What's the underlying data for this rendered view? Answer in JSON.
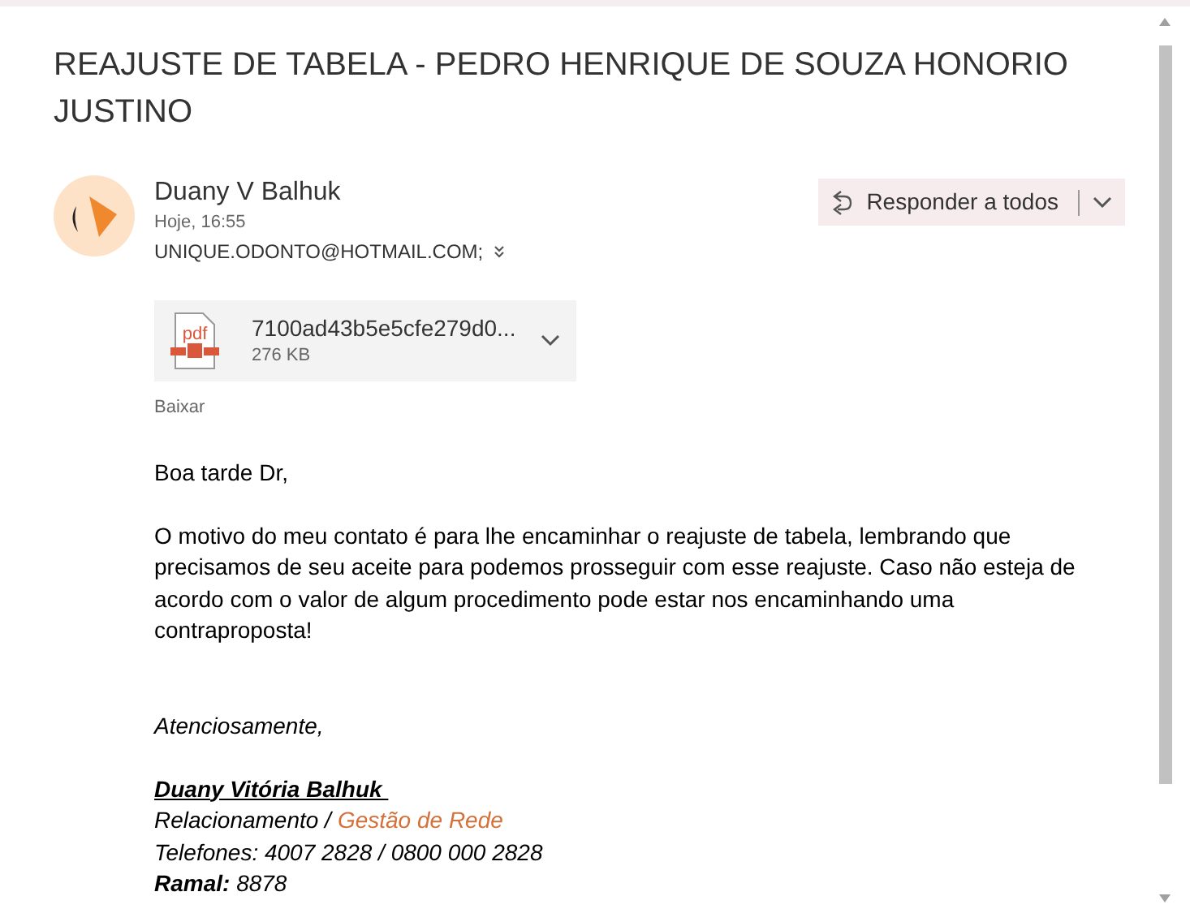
{
  "subject": "REAJUSTE DE TABELA - PEDRO HENRIQUE DE SOUZA HONORIO JUSTINO",
  "sender": {
    "name": "Duany V Balhuk",
    "time": "Hoje, 16:55",
    "to": "UNIQUE.ODONTO@HOTMAIL.COM;"
  },
  "reply_button": {
    "label": "Responder a todos"
  },
  "attachment": {
    "filename": "7100ad43b5e5cfe279d0...",
    "size": "276 KB",
    "file_type": "pdf",
    "download": "Baixar"
  },
  "body": [
    "Boa tarde Dr,",
    "O motivo do meu contato é para lhe encaminhar o reajuste de tabela, lembrando que precisamos de seu aceite para podemos prosseguir com esse reajuste. Caso não esteja de acordo com o valor de algum procedimento pode estar nos encaminhando uma contraproposta!"
  ],
  "closing": "Atenciosamente,",
  "signature": {
    "name": "Duany Vitória Balhuk ",
    "role": "Relacionamento /",
    "department": "Gestão de Rede",
    "phones": "Telefones: 4007 2828 / 0800 000 2828",
    "extension": "**Ramal:** 8878"
  }
}
